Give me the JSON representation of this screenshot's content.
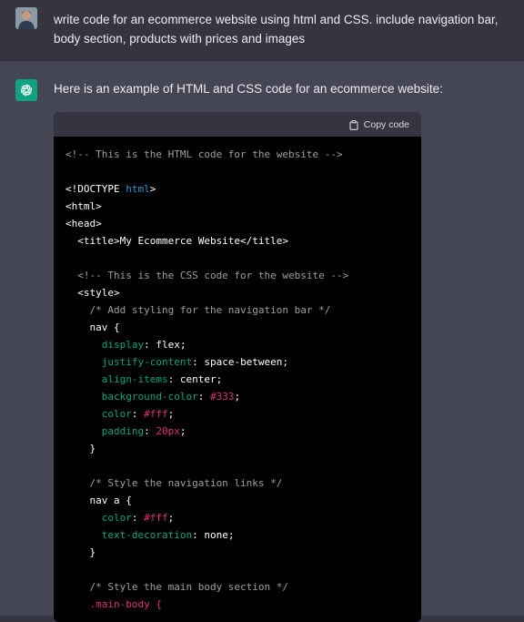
{
  "user_message": {
    "text": "write code for an ecommerce website using html and CSS. include navigation bar, body section, products with prices and images"
  },
  "assistant_message": {
    "intro": "Here is an example of HTML and CSS code for an ecommerce website:"
  },
  "code_block": {
    "copy_label": "Copy code",
    "lines": [
      {
        "text": "<!-- This is the HTML code for the website -->",
        "type": "comment"
      },
      {
        "text": "",
        "type": "blank"
      },
      {
        "text": "<!DOCTYPE ",
        "type": "tag",
        "extra": "html",
        "tail": ">"
      },
      {
        "text": "<html>",
        "type": "tag"
      },
      {
        "text": "<head>",
        "type": "tag"
      },
      {
        "text": "  <title>My Ecommerce Website</title>",
        "type": "tag"
      },
      {
        "text": "",
        "type": "blank"
      },
      {
        "text": "  <!-- This is the CSS code for the website -->",
        "type": "comment"
      },
      {
        "text": "  <style>",
        "type": "tag"
      },
      {
        "text": "    /* Add styling for the navigation bar */",
        "type": "comment"
      },
      {
        "text": "    nav {",
        "type": "tag"
      },
      {
        "prop": "      display",
        "val": "flex",
        "type": "decl",
        "valtype": "plain"
      },
      {
        "prop": "      justify-content",
        "val": "space-between",
        "type": "decl",
        "valtype": "plain"
      },
      {
        "prop": "      align-items",
        "val": "center",
        "type": "decl",
        "valtype": "plain"
      },
      {
        "prop": "      background-color",
        "val": "#333",
        "type": "decl",
        "valtype": "str"
      },
      {
        "prop": "      color",
        "val": "#fff",
        "type": "decl",
        "valtype": "str"
      },
      {
        "prop": "      padding",
        "val": "20px",
        "type": "decl",
        "valtype": "str"
      },
      {
        "text": "    }",
        "type": "tag"
      },
      {
        "text": "",
        "type": "blank"
      },
      {
        "text": "    /* Style the navigation links */",
        "type": "comment"
      },
      {
        "text": "    nav a {",
        "type": "tag"
      },
      {
        "prop": "      color",
        "val": "#fff",
        "type": "decl",
        "valtype": "str"
      },
      {
        "prop": "      text-decoration",
        "val": "none",
        "type": "decl",
        "valtype": "plain"
      },
      {
        "text": "    }",
        "type": "tag"
      },
      {
        "text": "",
        "type": "blank"
      },
      {
        "text": "    /* Style the main body section */",
        "type": "comment"
      },
      {
        "text": "    .main-body {",
        "type": "selector"
      }
    ]
  },
  "colors": {
    "background": "#343541",
    "assistant_bg": "#444654",
    "code_bg": "#000000",
    "accent": "#10a37f",
    "keyword": "#2e95d3",
    "property": "#00a67d",
    "string": "#df3079",
    "comment": "#9aa0a6"
  }
}
